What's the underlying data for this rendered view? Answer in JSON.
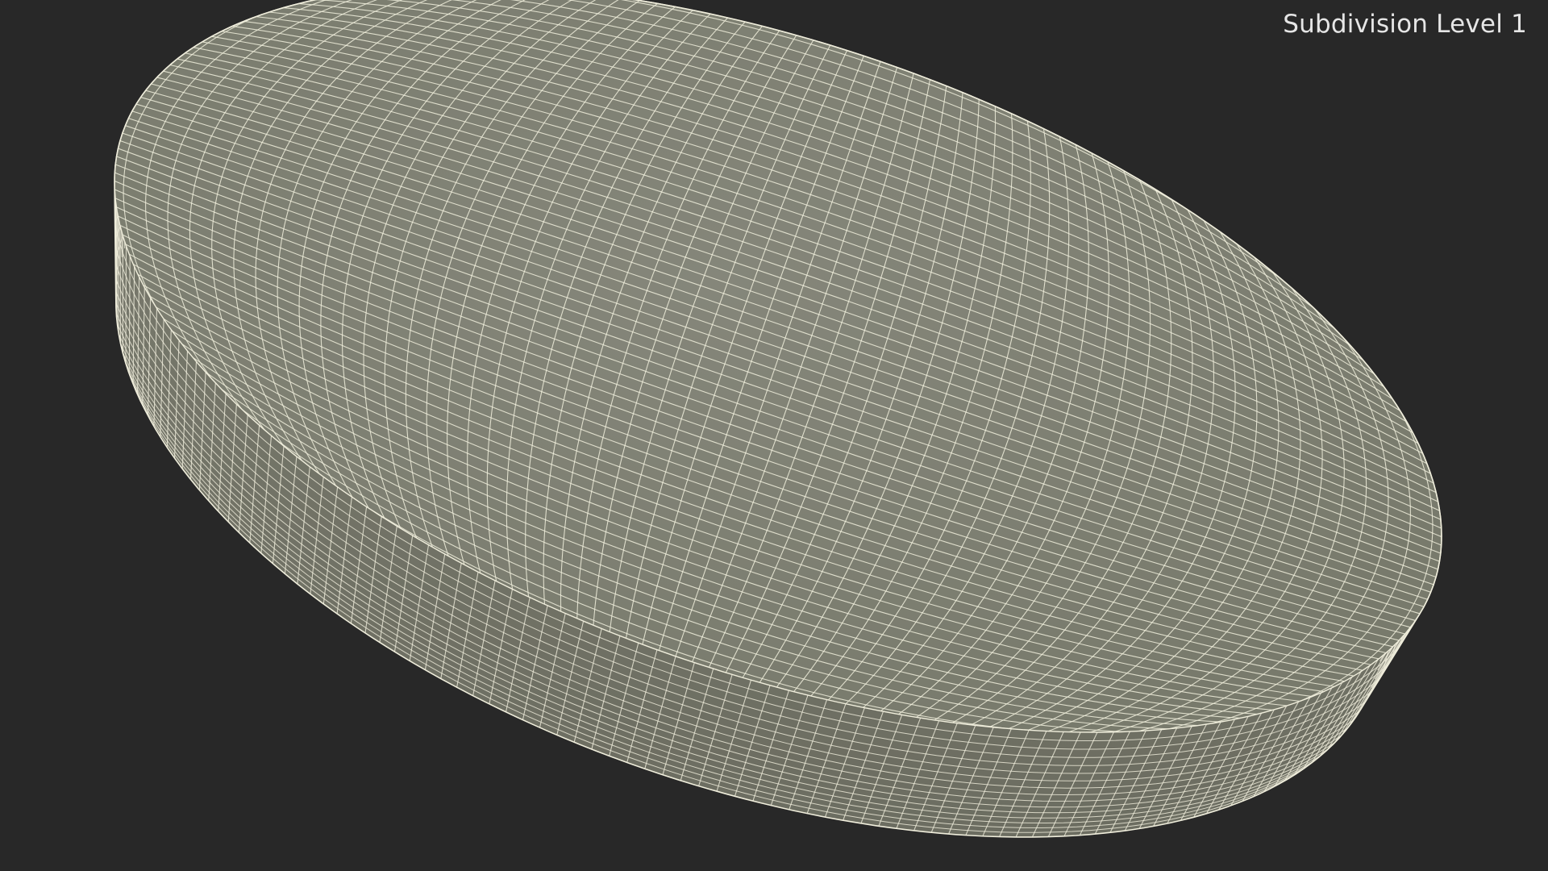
{
  "viewport": {
    "label": "Subdivision Level 1",
    "colors": {
      "background": "#282828",
      "surface": "#7d7e70",
      "surface_shadow": "#6e6f62",
      "wire": "#f0eedc"
    }
  }
}
